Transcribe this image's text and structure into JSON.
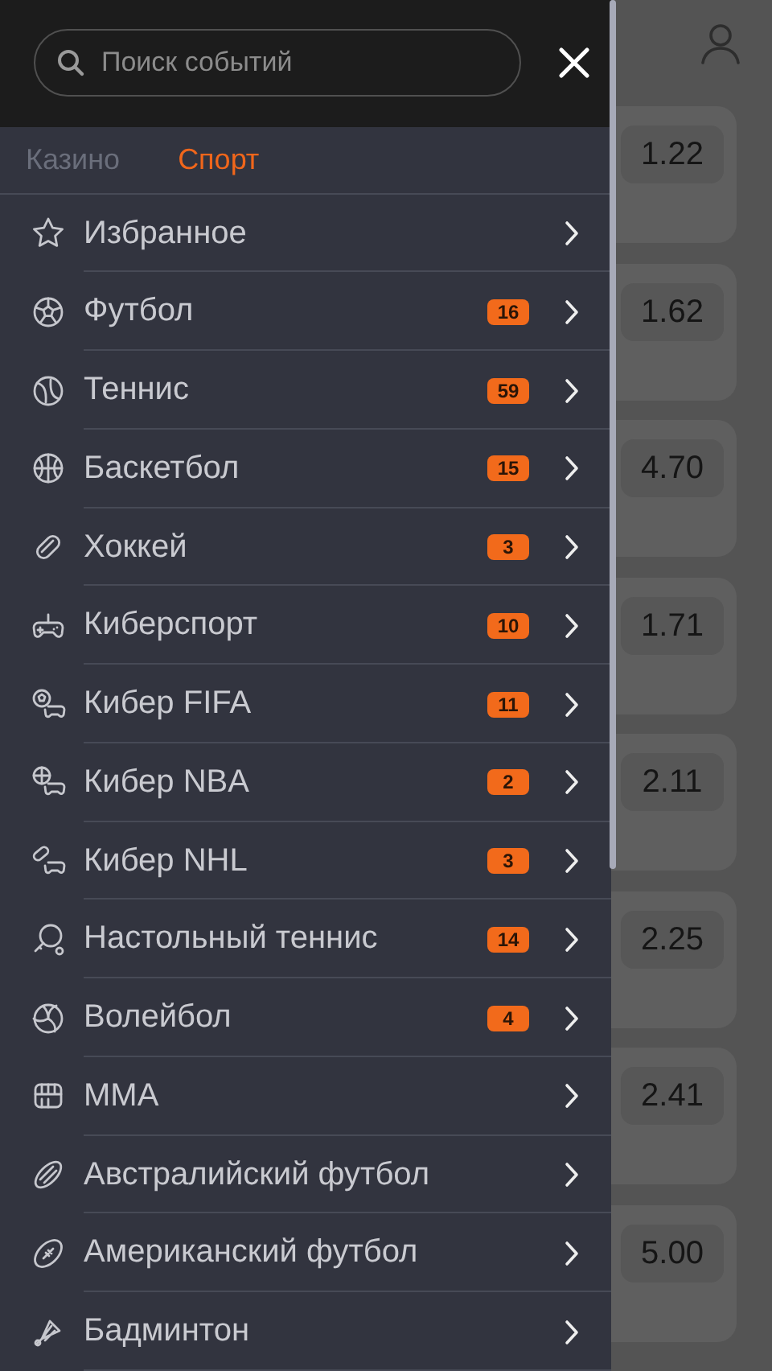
{
  "search": {
    "placeholder": "Поиск событий"
  },
  "tabs": [
    {
      "label": "Казино",
      "selected": false
    },
    {
      "label": "Спорт",
      "selected": true
    }
  ],
  "menu": [
    {
      "label": "Избранное"
    },
    {
      "label": "Футбол",
      "count": "16"
    },
    {
      "label": "Теннис",
      "count": "59"
    },
    {
      "label": "Баскетбол",
      "count": "15"
    },
    {
      "label": "Хоккей",
      "count": "3"
    },
    {
      "label": "Киберспорт",
      "count": "10"
    },
    {
      "label": "Кибер FIFA",
      "count": "11"
    },
    {
      "label": "Кибер NBA",
      "count": "2"
    },
    {
      "label": "Кибер NHL",
      "count": "3"
    },
    {
      "label": "Настольный теннис",
      "count": "14"
    },
    {
      "label": "Волейбол",
      "count": "4"
    },
    {
      "label": "MMA"
    },
    {
      "label": "Австралийский футбол"
    },
    {
      "label": "Американский футбол"
    },
    {
      "label": "Бадминтон"
    }
  ],
  "odds": [
    "1.22",
    "1.62",
    "4.70",
    "1.71",
    "2.11",
    "2.25",
    "2.41",
    "5.00"
  ]
}
